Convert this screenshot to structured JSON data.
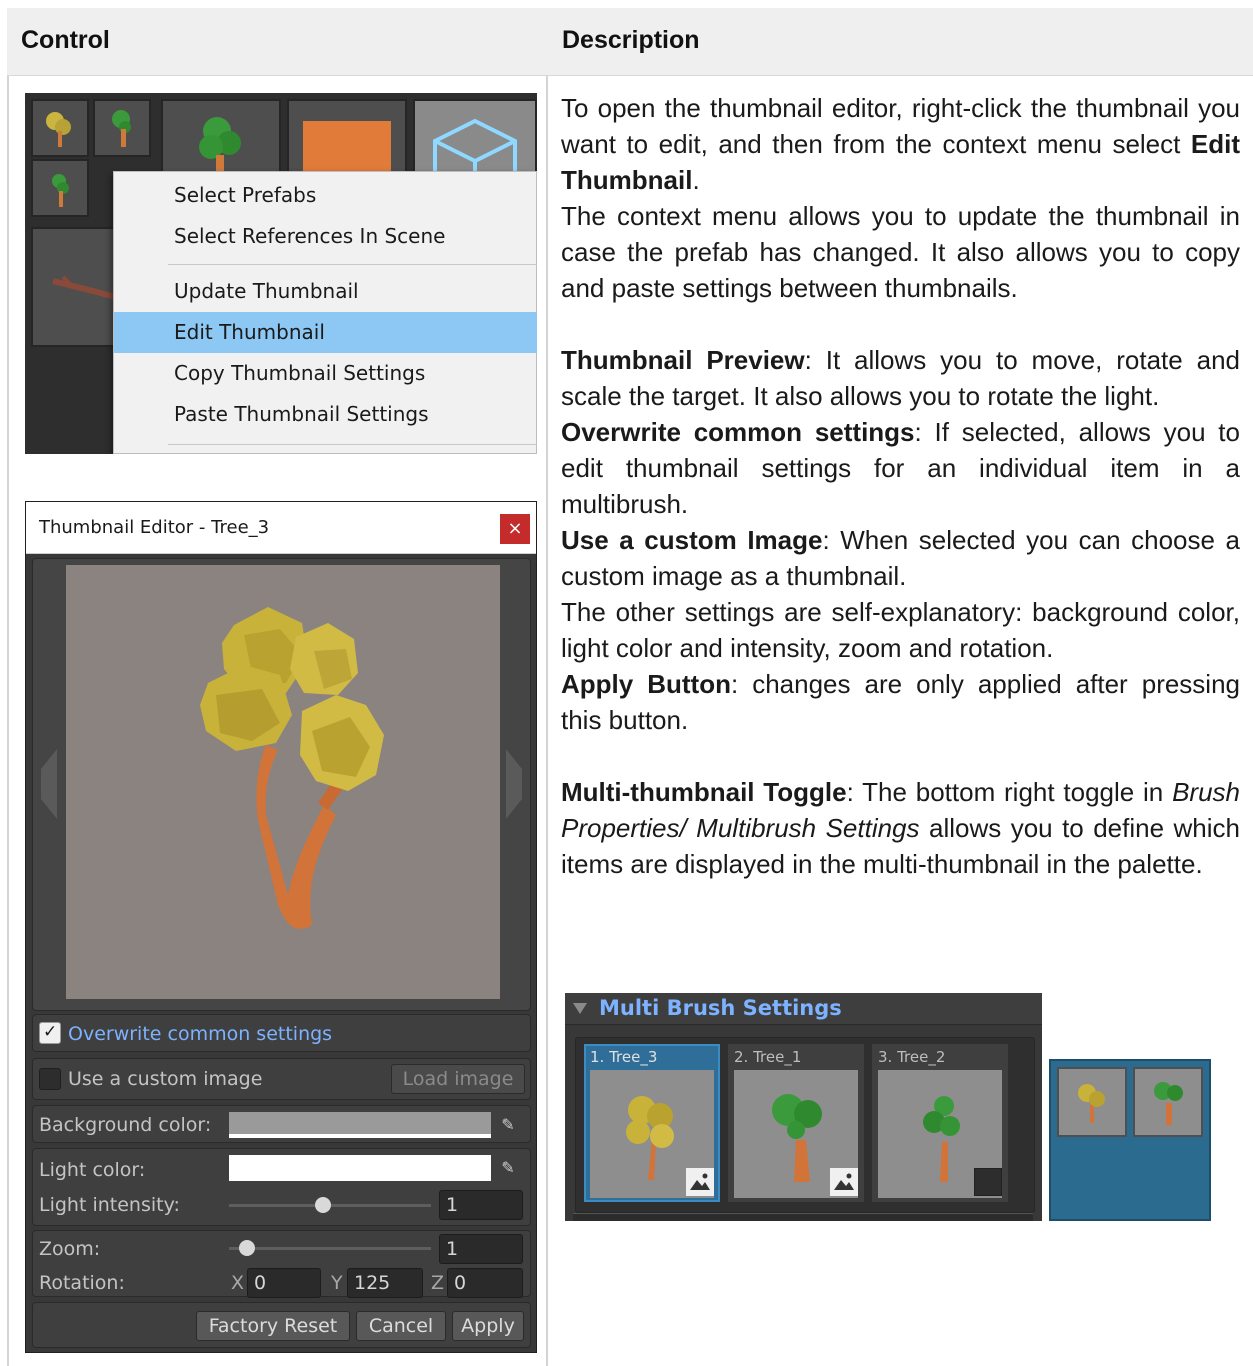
{
  "table": {
    "header_control": "Control",
    "header_description": "Description"
  },
  "context_menu": {
    "items": [
      "Select Prefabs",
      "Select References In Scene",
      "Update Thumbnail",
      "Edit Thumbnail",
      "Copy Thumbnail Settings",
      "Paste Thumbnail Settings"
    ],
    "selected": "Edit Thumbnail"
  },
  "editor": {
    "title": "Thumbnail Editor - Tree_3",
    "close": "×",
    "overwrite_label": "Overwrite common settings",
    "overwrite_checked": true,
    "custom_image_label": "Use a custom image",
    "custom_image_checked": false,
    "load_image": "Load image",
    "background_label": "Background color:",
    "light_color_label": "Light color:",
    "light_intensity_label": "Light intensity:",
    "light_intensity": "1",
    "zoom_label": "Zoom:",
    "zoom": "1",
    "rotation_label": "Rotation:",
    "rot_x_label": "X",
    "rot_x": "0",
    "rot_y_label": "Y",
    "rot_y": "125",
    "rot_z_label": "Z",
    "rot_z": "0",
    "factory_reset": "Factory Reset",
    "cancel": "Cancel",
    "apply": "Apply",
    "background_color": "#ffffff",
    "light_color": "#ffffff",
    "accent": "#7cb2ff"
  },
  "description": {
    "p1_a": "To open the thumbnail editor, right-click the thumbnail you want to edit, and then from the context menu select ",
    "p1_b": "Edit Thumbnail",
    "p1_c": ".",
    "p2": "The context menu allows you to update the thumbnail in case the prefab has changed. It also allows you to copy and paste settings between thumbnails.",
    "p3_b": "Thumbnail Preview",
    "p3": ": It allows you to move, rotate and scale the target. It also allows you to rotate the light.",
    "p4_b": "Overwrite common settings",
    "p4": ": If selected, allows you to edit thumbnail settings for an individual item in a multibrush.",
    "p5_b": "Use a custom Image",
    "p5": ": When selected you can choose a custom image as a thumbnail.",
    "p6": "The other settings are self-explanatory: background color, light color and intensity, zoom and rotation.",
    "p7_b": "Apply Button",
    "p7": ": changes are only applied after pressing this button.",
    "p8_b": "Multi-thumbnail Toggle",
    "p8_a": ": The bottom right toggle in ",
    "p8_i": "Brush Properties/ Multibrush Settings",
    "p8_c": " allows you to define which items are displayed in the multi-thumbnail in the palette."
  },
  "multibrush": {
    "title": "Multi Brush Settings",
    "items": [
      {
        "label": "1. Tree_3",
        "selected": true,
        "toggle": true
      },
      {
        "label": "2. Tree_1",
        "selected": false,
        "toggle": true
      },
      {
        "label": "3. Tree_2",
        "selected": false,
        "toggle": false
      }
    ]
  }
}
